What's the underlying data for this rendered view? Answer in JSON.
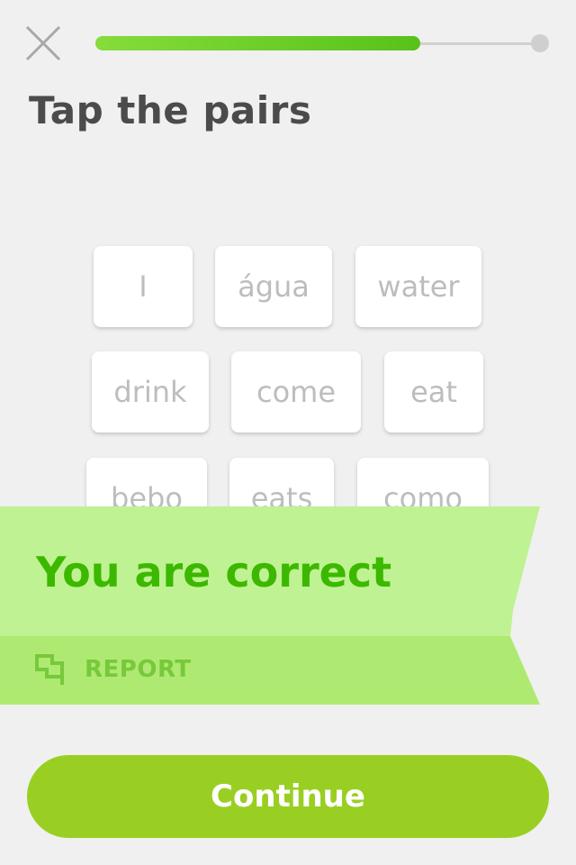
{
  "lesson": {
    "progress": 0.73,
    "title": "Tap the pairs"
  },
  "tiles": [
    "I",
    "água",
    "water",
    "drink",
    "come",
    "eat",
    "bebo",
    "eats",
    "como"
  ],
  "feedback": {
    "message": "You are correct",
    "report_label": "REPORT"
  },
  "footer": {
    "continue_label": "Continue"
  },
  "colors": {
    "accent_green": "#3cb800",
    "progress": "#58c21a",
    "ribbon": "#bff292",
    "button": "#99cf23"
  }
}
